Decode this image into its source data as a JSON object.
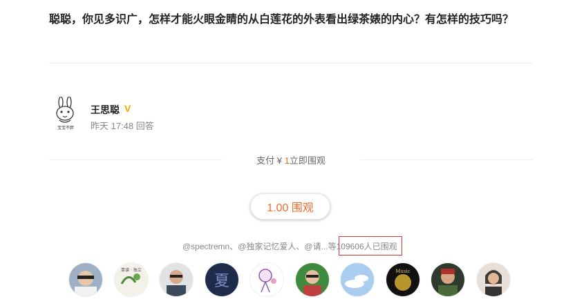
{
  "question": {
    "text": "聪聪，你见多识广，怎样才能火眼金睛的从白莲花的外表看出绿茶婊的内心？有怎样的技巧吗？"
  },
  "answer": {
    "author_name": "王思聪",
    "verified_badge": "V",
    "meta": "昨天 17:48 回答",
    "avatar_caption": "宝宝不胖"
  },
  "pay": {
    "prefix": "支付 ¥ ",
    "amount": "1",
    "suffix": "立即围观"
  },
  "watch_button": {
    "label": "1.00 围观"
  },
  "watchers": {
    "names_text": "@spectremn、@独家记忆爱人、@请...等",
    "count_text": "109606人已围观"
  },
  "watcher_avatars": [
    {
      "name": "watcher-avatar-1"
    },
    {
      "name": "watcher-avatar-2",
      "text": "靠谱 · 独立"
    },
    {
      "name": "watcher-avatar-3"
    },
    {
      "name": "watcher-avatar-4",
      "text": "夏"
    },
    {
      "name": "watcher-avatar-5"
    },
    {
      "name": "watcher-avatar-6"
    },
    {
      "name": "watcher-avatar-7"
    },
    {
      "name": "watcher-avatar-8",
      "text": "Music"
    },
    {
      "name": "watcher-avatar-9"
    },
    {
      "name": "watcher-avatar-10"
    }
  ],
  "colors": {
    "accent": "#f26b2e",
    "badge": "#f5a800",
    "highlight_box": "#d9362b"
  }
}
